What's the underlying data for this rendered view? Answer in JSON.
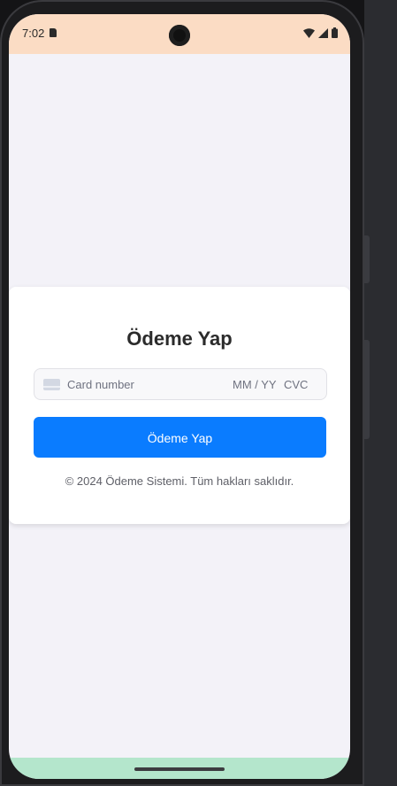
{
  "status_bar": {
    "time": "7:02",
    "icons": [
      "sim-card-icon",
      "wifi-icon",
      "signal-icon",
      "battery-icon"
    ],
    "background": "#fbdcc4"
  },
  "payment_card": {
    "title": "Ödeme Yap",
    "card_number_placeholder": "Card number",
    "expiry_placeholder": "MM / YY",
    "cvc_placeholder": "CVC",
    "card_icon": "credit-card-icon",
    "submit_label": "Ödeme Yap",
    "footer": "© 2024 Ödeme Sistemi. Tüm hakları saklıdır."
  },
  "colors": {
    "accent": "#0a7cff",
    "page_background": "#f3f2f8",
    "nav_bar": "#b4e6cc"
  }
}
